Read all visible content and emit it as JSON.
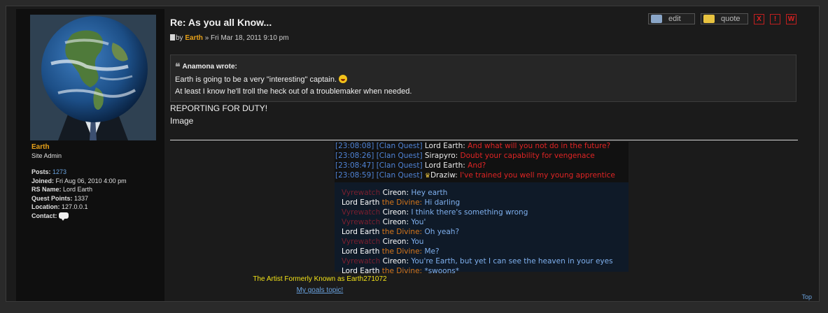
{
  "profile": {
    "username": "Earth",
    "rank": "Site Admin",
    "details": [
      {
        "label": "Posts:",
        "value": "1273",
        "link": true
      },
      {
        "label": "Joined:",
        "value": "Fri Aug 06, 2010 4:00 pm",
        "link": false
      },
      {
        "label": "RS Name:",
        "value": "Lord Earth",
        "link": false
      },
      {
        "label": "Quest Points:",
        "value": "1337",
        "link": false
      },
      {
        "label": "Location:",
        "value": "127.0.0.1",
        "link": false
      },
      {
        "label": "Contact:",
        "value": "",
        "link": false
      }
    ]
  },
  "post": {
    "title": "Re: As you all Know...",
    "meta_by": "by",
    "author": "Earth",
    "sep": "»",
    "date": "Fri Mar 18, 2011 9:10 pm",
    "actions": {
      "edit": "edit",
      "quote": "quote",
      "delete": "X",
      "report": "!",
      "warn": "W"
    },
    "quote": {
      "author_line": "Anamona wrote:",
      "line1": "Earth is going to be a very \"interesting\" captain.",
      "line2": "At least I know he'll troll the heck out of a troublemaker when needed."
    },
    "body_line1": "REPORTING FOR DUTY!",
    "body_line2": "Image"
  },
  "signature": {
    "clan_chat": [
      {
        "time": "[23:08:08]",
        "channel": "[Clan Quest]",
        "speaker": "Lord Earth:",
        "message": "And what will you not do in the future?",
        "crown": false
      },
      {
        "time": "[23:08:26]",
        "channel": "[Clan Quest]",
        "speaker": "Sirapyro:",
        "message": "Doubt your capability for vengenace",
        "crown": false
      },
      {
        "time": "[23:08:47]",
        "channel": "[Clan Quest]",
        "speaker": "Lord Earth:",
        "message": "And?",
        "crown": false
      },
      {
        "time": "[23:08:59]",
        "channel": "[Clan Quest]",
        "speaker": "Draziw:",
        "message": "I've trained you well my young apprentice",
        "crown": true
      }
    ],
    "dialogue": [
      {
        "prefix": "Vyrewatch",
        "name": "Cireon:",
        "message": "Hey earth",
        "who": "cireon"
      },
      {
        "prefix": "Lord Earth",
        "name": "the Divine:",
        "message": "Hi darling",
        "who": "earth"
      },
      {
        "prefix": "Vyrewatch",
        "name": "Cireon:",
        "message": "I think there's something wrong",
        "who": "cireon"
      },
      {
        "prefix": "Vyrewatch",
        "name": "Cireon:",
        "message": "You'",
        "who": "cireon"
      },
      {
        "prefix": "Lord Earth",
        "name": "the Divine:",
        "message": "Oh yeah?",
        "who": "earth"
      },
      {
        "prefix": "Vyrewatch",
        "name": "Cireon:",
        "message": "You",
        "who": "cireon"
      },
      {
        "prefix": "Lord Earth",
        "name": "the Divine:",
        "message": "Me?",
        "who": "earth"
      },
      {
        "prefix": "Vyrewatch",
        "name": "Cireon:",
        "message": "You're Earth, but yet I can see the heaven in your eyes",
        "who": "cireon"
      },
      {
        "prefix": "Lord Earth",
        "name": "the Divine:",
        "message": "*swoons*",
        "who": "earth"
      }
    ],
    "caption": "The Artist Formerly Known as Earth271072",
    "link": "My goals topic!"
  },
  "top_link": "Top"
}
